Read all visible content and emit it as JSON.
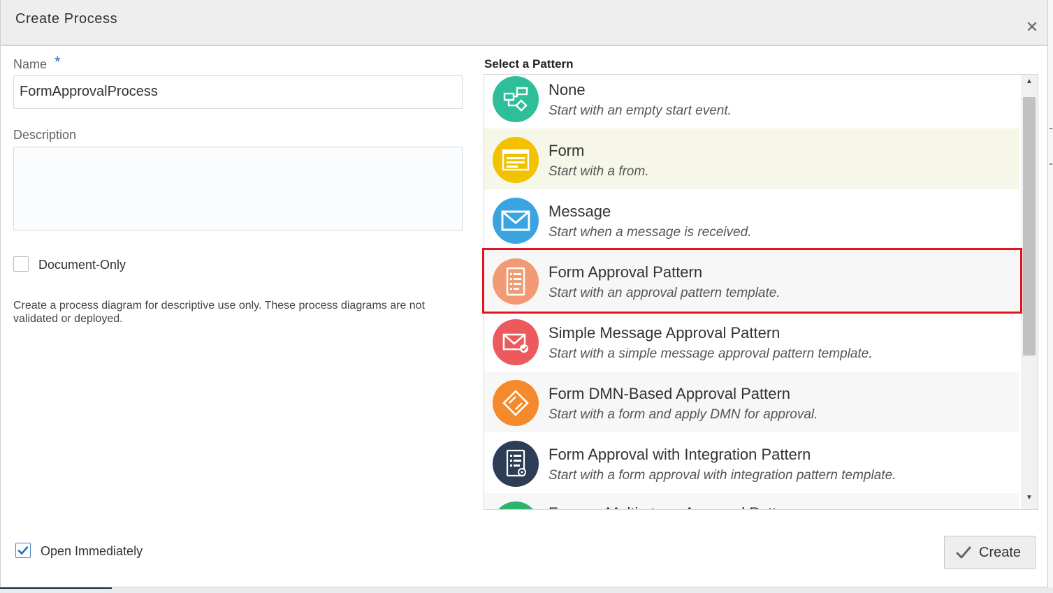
{
  "dialog": {
    "title": "Create Process",
    "close_icon": "close-icon"
  },
  "form": {
    "name_label": "Name",
    "required_marker": "*",
    "name_value": "FormApprovalProcess",
    "description_label": "Description",
    "description_value": "",
    "document_only_label": "Document-Only",
    "document_only_checked": false,
    "helper_text": "Create a process diagram for descriptive use only. These process diagrams are not validated or deployed.",
    "open_immediately_label": "Open Immediately",
    "open_immediately_checked": true
  },
  "patterns": {
    "heading": "Select a Pattern",
    "selected": "Form Approval Pattern",
    "items": [
      {
        "name": "None",
        "desc": "Start with an empty start event.",
        "icon": "flow-icon",
        "color": "#2ebf9a"
      },
      {
        "name": "Form",
        "desc": "Start with a from.",
        "icon": "form-icon",
        "color": "#f2c200"
      },
      {
        "name": "Message",
        "desc": "Start when a message is received.",
        "icon": "envelope-icon",
        "color": "#3aa4e0"
      },
      {
        "name": "Form Approval Pattern",
        "desc": "Start with an approval pattern template.",
        "icon": "checklist-icon",
        "color": "#f29a73"
      },
      {
        "name": "Simple Message Approval Pattern",
        "desc": "Start with a simple message approval pattern template.",
        "icon": "envelope-check-icon",
        "color": "#ec5a5e"
      },
      {
        "name": "Form DMN-Based Approval Pattern",
        "desc": "Start with a form and apply DMN for approval.",
        "icon": "dmn-icon",
        "color": "#f58a2c"
      },
      {
        "name": "Form Approval with Integration Pattern",
        "desc": "Start with a form approval with integration pattern template.",
        "icon": "integration-icon",
        "color": "#2c3e55"
      },
      {
        "name": "Form ... Multi-stage Approval Pattern",
        "desc": "",
        "icon": "multistage-icon",
        "color": "#2db36a"
      }
    ]
  },
  "actions": {
    "create_label": "Create",
    "create_icon": "check-icon"
  }
}
